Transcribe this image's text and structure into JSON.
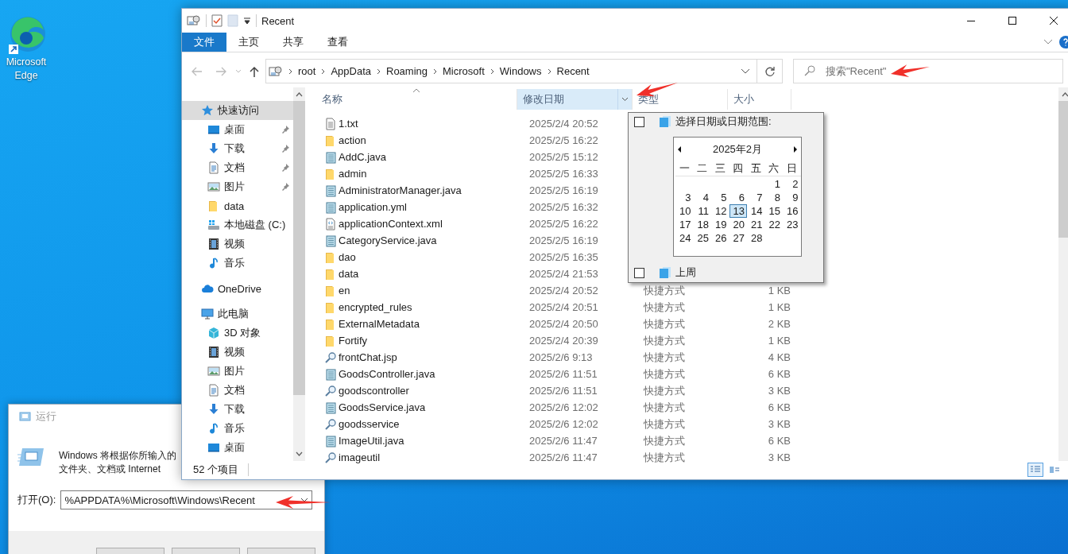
{
  "desktop": {
    "icons": [
      {
        "label": "Microsoft Edge"
      }
    ]
  },
  "run_dialog": {
    "title": "运行",
    "description_lines": [
      "Windows 将根据你所输入的",
      "文件夹、文档或 Internet"
    ],
    "open_label": "打开(O):",
    "open_value": "%APPDATA%\\Microsoft\\Windows\\Recent"
  },
  "explorer": {
    "title": "Recent",
    "ribbon_tabs": [
      {
        "label": "文件",
        "selected": true
      },
      {
        "label": "主页",
        "selected": false
      },
      {
        "label": "共享",
        "selected": false
      },
      {
        "label": "查看",
        "selected": false
      }
    ],
    "breadcrumb": [
      "root",
      "AppData",
      "Roaming",
      "Microsoft",
      "Windows",
      "Recent"
    ],
    "search": {
      "placeholder": "搜索\"Recent\""
    },
    "nav": [
      {
        "label": "快速访问",
        "kind": "star",
        "selected": true,
        "pinned": false,
        "children": [
          {
            "label": "桌面",
            "kind": "desktop",
            "selected": false,
            "pinned": true
          },
          {
            "label": "下载",
            "kind": "download",
            "selected": false,
            "pinned": true
          },
          {
            "label": "文档",
            "kind": "document",
            "selected": false,
            "pinned": true
          },
          {
            "label": "图片",
            "kind": "picture",
            "selected": false,
            "pinned": true
          },
          {
            "label": "data",
            "kind": "folder",
            "selected": false,
            "pinned": false
          },
          {
            "label": "本地磁盘 (C:)",
            "kind": "drive",
            "selected": false,
            "pinned": false
          },
          {
            "label": "视频",
            "kind": "video",
            "selected": false,
            "pinned": false
          },
          {
            "label": "音乐",
            "kind": "music",
            "selected": false,
            "pinned": false
          }
        ]
      },
      {
        "label": "OneDrive",
        "kind": "cloud",
        "selected": false,
        "pinned": false
      },
      {
        "label": "此电脑",
        "kind": "pc",
        "selected": false,
        "pinned": false,
        "children": [
          {
            "label": "3D 对象",
            "kind": "cube",
            "selected": false,
            "pinned": false
          },
          {
            "label": "视频",
            "kind": "video",
            "selected": false,
            "pinned": false
          },
          {
            "label": "图片",
            "kind": "picture",
            "selected": false,
            "pinned": false
          },
          {
            "label": "文档",
            "kind": "document",
            "selected": false,
            "pinned": false
          },
          {
            "label": "下载",
            "kind": "download",
            "selected": false,
            "pinned": false
          },
          {
            "label": "音乐",
            "kind": "music",
            "selected": false,
            "pinned": false
          },
          {
            "label": "桌面",
            "kind": "desktop",
            "selected": false,
            "pinned": false
          }
        ]
      }
    ],
    "columns": [
      {
        "label": "名称",
        "sorted": true,
        "hover": false
      },
      {
        "label": "修改日期",
        "sorted": false,
        "hover": true
      },
      {
        "label": "类型",
        "sorted": false,
        "hover": false
      },
      {
        "label": "大小",
        "sorted": false,
        "hover": false
      }
    ],
    "files": [
      {
        "name": "1.txt",
        "kind": "text",
        "date": "2025/2/4 20:52"
      },
      {
        "name": "action",
        "kind": "folder",
        "date": "2025/2/5 16:22"
      },
      {
        "name": "AddC.java",
        "kind": "notepad",
        "date": "2025/2/5 15:12"
      },
      {
        "name": "admin",
        "kind": "folder",
        "date": "2025/2/5 16:33"
      },
      {
        "name": "AdministratorManager.java",
        "kind": "notepad",
        "date": "2025/2/5 16:19"
      },
      {
        "name": "application.yml",
        "kind": "notepad",
        "date": "2025/2/5 16:32"
      },
      {
        "name": "applicationContext.xml",
        "kind": "xml",
        "date": "2025/2/5 16:22"
      },
      {
        "name": "CategoryService.java",
        "kind": "notepad",
        "date": "2025/2/5 16:19"
      },
      {
        "name": "dao",
        "kind": "folder",
        "date": "2025/2/5 16:35"
      },
      {
        "name": "data",
        "kind": "folder",
        "date": "2025/2/4 21:53"
      },
      {
        "name": "en",
        "kind": "folder",
        "date": "2025/2/4 20:52",
        "type": "快捷方式",
        "size": "1 KB"
      },
      {
        "name": "encrypted_rules",
        "kind": "folder",
        "date": "2025/2/4 20:51",
        "type": "快捷方式",
        "size": "1 KB"
      },
      {
        "name": "ExternalMetadata",
        "kind": "folder",
        "date": "2025/2/4 20:50",
        "type": "快捷方式",
        "size": "2 KB"
      },
      {
        "name": "Fortify",
        "kind": "folder",
        "date": "2025/2/4 20:39",
        "type": "快捷方式",
        "size": "1 KB"
      },
      {
        "name": "frontChat.jsp",
        "kind": "search",
        "date": "2025/2/6 9:13",
        "type": "快捷方式",
        "size": "4 KB"
      },
      {
        "name": "GoodsController.java",
        "kind": "notepad",
        "date": "2025/2/6 11:51",
        "type": "快捷方式",
        "size": "6 KB"
      },
      {
        "name": "goodscontroller",
        "kind": "search",
        "date": "2025/2/6 11:51",
        "type": "快捷方式",
        "size": "3 KB"
      },
      {
        "name": "GoodsService.java",
        "kind": "notepad",
        "date": "2025/2/6 12:02",
        "type": "快捷方式",
        "size": "6 KB"
      },
      {
        "name": "goodsservice",
        "kind": "search",
        "date": "2025/2/6 12:02",
        "type": "快捷方式",
        "size": "3 KB"
      },
      {
        "name": "ImageUtil.java",
        "kind": "notepad",
        "date": "2025/2/6 11:47",
        "type": "快捷方式",
        "size": "6 KB"
      },
      {
        "name": "imageutil",
        "kind": "search",
        "date": "2025/2/6 11:47",
        "type": "快捷方式",
        "size": "3 KB"
      }
    ],
    "status": "52 个项目",
    "views": [
      {
        "kind": "details",
        "selected": true
      },
      {
        "kind": "tiles",
        "selected": false
      }
    ],
    "date_filter": {
      "range_option": {
        "label": "选择日期或日期范围:",
        "checked": false
      },
      "calendar": {
        "month": "2025年2月",
        "weekdays": [
          "一",
          "二",
          "三",
          "四",
          "五",
          "六",
          "日"
        ],
        "weeks": [
          [
            {
              "day": "1",
              "selected": false
            },
            {
              "day": "2",
              "selected": false
            }
          ],
          [
            {
              "day": "3",
              "selected": false
            },
            {
              "day": "4",
              "selected": false
            },
            {
              "day": "5",
              "selected": false
            },
            {
              "day": "6",
              "selected": false
            },
            {
              "day": "7",
              "selected": false
            },
            {
              "day": "8",
              "selected": false
            },
            {
              "day": "9",
              "selected": false
            }
          ],
          [
            {
              "day": "10",
              "selected": false
            },
            {
              "day": "11",
              "selected": false
            },
            {
              "day": "12",
              "selected": false
            },
            {
              "day": "13",
              "selected": true
            },
            {
              "day": "14",
              "selected": false
            },
            {
              "day": "15",
              "selected": false
            },
            {
              "day": "16",
              "selected": false
            }
          ],
          [
            {
              "day": "17",
              "selected": false
            },
            {
              "day": "18",
              "selected": false
            },
            {
              "day": "19",
              "selected": false
            },
            {
              "day": "20",
              "selected": false
            },
            {
              "day": "21",
              "selected": false
            },
            {
              "day": "22",
              "selected": false
            },
            {
              "day": "23",
              "selected": false
            }
          ],
          [
            {
              "day": "24",
              "selected": false
            },
            {
              "day": "25",
              "selected": false
            },
            {
              "day": "26",
              "selected": false
            },
            {
              "day": "27",
              "selected": false
            },
            {
              "day": "28",
              "selected": false
            }
          ]
        ]
      },
      "presets": [
        {
          "label": "上周",
          "checked": false
        }
      ]
    }
  }
}
